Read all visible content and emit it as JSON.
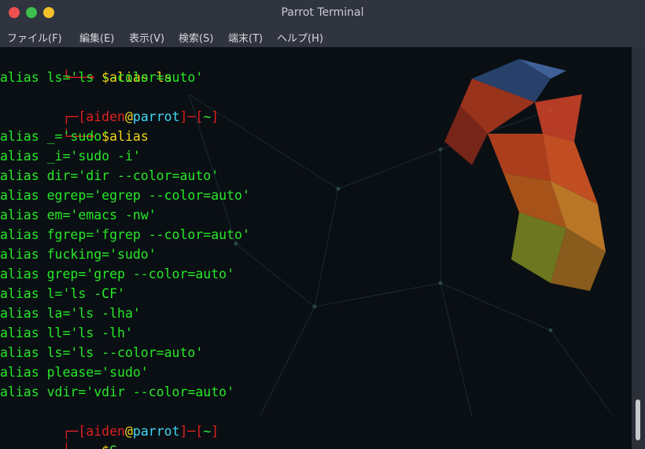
{
  "window": {
    "title": "Parrot Terminal"
  },
  "menu": [
    "ファイル(F)",
    "編集(E)",
    "表示(V)",
    "検索(S)",
    "端末(T)",
    "ヘルプ(H)"
  ],
  "prompt": {
    "user": "aiden",
    "at": "@",
    "host": "parrot",
    "open": "[",
    "close": "]",
    "sep": "─",
    "cwd": "~"
  },
  "terminal": {
    "cmd1": "$alias ls",
    "out1": "alias ls='ls --color=auto'",
    "cmd2": "$alias",
    "aliases": [
      "alias _='sudo'",
      "alias _i='sudo -i'",
      "alias dir='dir --color=auto'",
      "alias egrep='egrep --color=auto'",
      "alias em='emacs -nw'",
      "alias fgrep='fgrep --color=auto'",
      "alias fucking='sudo'",
      "alias grep='grep --color=auto'",
      "alias l='ls -CF'",
      "alias la='ls -lha'",
      "alias ll='ls -lh'",
      "alias ls='ls --color=auto'",
      "alias please='sudo'",
      "alias vdir='vdir --color=auto'"
    ],
    "cmd3_dollar": "$",
    "cmd3_char": "S"
  },
  "colors": {
    "prompt_red": "#e02020",
    "output_green": "#27e827",
    "dollar_yellow": "#f2d515",
    "host_cyan": "#42d7f5"
  }
}
